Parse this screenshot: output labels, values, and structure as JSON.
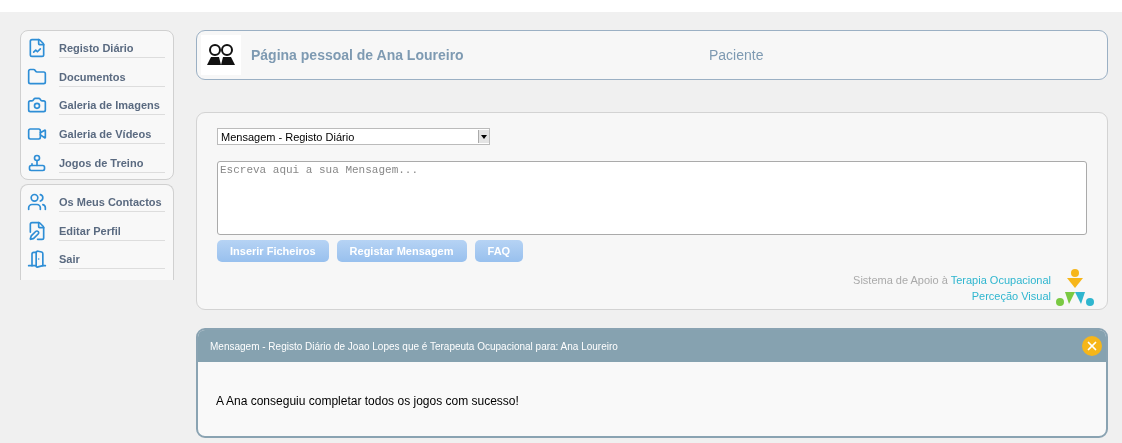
{
  "sidebar": {
    "groups": [
      {
        "items": [
          {
            "label": "Registo Diário",
            "kind": "chart"
          },
          {
            "label": "Documentos",
            "kind": "folder"
          },
          {
            "label": "Galeria de Imagens",
            "kind": "camera"
          },
          {
            "label": "Galeria de Vídeos",
            "kind": "video"
          },
          {
            "label": "Jogos de Treino",
            "kind": "joystick"
          }
        ]
      },
      {
        "items": [
          {
            "label": "Os Meus Contactos",
            "kind": "contacts"
          },
          {
            "label": "Editar Perfil",
            "kind": "edit"
          },
          {
            "label": "Sair",
            "kind": "exit"
          }
        ]
      }
    ]
  },
  "header": {
    "title": "Página pessoal de Ana Loureiro",
    "role": "Paciente"
  },
  "composer": {
    "select_value": "Mensagem - Registo Diário",
    "placeholder": "Escreva aqui a sua Mensagem...",
    "buttons": [
      "Inserir Ficheiros",
      "Registar Mensagem",
      "FAQ"
    ],
    "footer": {
      "prefix": "Sistema de Apoio à",
      "line1": "Terapia Ocupacional",
      "line2": "Perceção Visual"
    }
  },
  "message": {
    "title": "Mensagem - Registo Diário de Joao Lopes que é Terapeuta Ocupacional para: Ana Loureiro",
    "body": "A Ana conseguiu completar todos os jogos com sucesso!"
  }
}
